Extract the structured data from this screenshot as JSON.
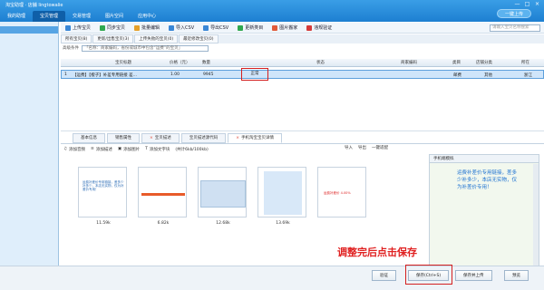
{
  "app": {
    "title": "淘宝助理 · 店舖 lingtowalie",
    "minimize_label": "—",
    "maximize_label": "□",
    "close_label": "×"
  },
  "mainnav": {
    "tabs": [
      {
        "label": "我的助理"
      },
      {
        "label": "宝贝管理"
      },
      {
        "label": "交易管理"
      },
      {
        "label": "图片空间"
      },
      {
        "label": "应用中心"
      }
    ],
    "onekey_label": "一键上传"
  },
  "toolbar": {
    "items": [
      {
        "label": "上传宝贝",
        "icon": "upload-icon",
        "color": "#3a87d6"
      },
      {
        "label": "同步宝贝",
        "icon": "sync-icon",
        "color": "#2fa84f"
      },
      {
        "label": "批量编辑",
        "icon": "edit-icon",
        "color": "#e5a02a"
      },
      {
        "label": "导入CSV",
        "icon": "import-icon",
        "color": "#3a87d6"
      },
      {
        "label": "导出CSV",
        "icon": "export-icon",
        "color": "#3a87d6"
      },
      {
        "label": "更新类目",
        "icon": "refresh-icon",
        "color": "#2fa84f"
      },
      {
        "label": "图片搬家",
        "icon": "image-icon",
        "color": "#e15b3a"
      },
      {
        "label": "违规验证",
        "icon": "check-icon",
        "color": "#d43a3a"
      }
    ],
    "search_placeholder": "请输入宝贝名称搜索"
  },
  "subtabs": [
    {
      "label": "所有宝贝(8)"
    },
    {
      "label": "更新/出售宝贝(3)"
    },
    {
      "label": "上传失败的宝贝(0)"
    },
    {
      "label": "最近修改宝贝(0)"
    }
  ],
  "filter": {
    "label": "高级条件",
    "value": "「名称：商家编码，省份或城市中包含“运费”的宝贝」"
  },
  "grid": {
    "headers": [
      "宝贝标题",
      "价格（元）",
      "数量",
      "状态",
      "商家编码",
      "类目",
      "店铺分类",
      "所在"
    ],
    "row": {
      "index": "1",
      "title": "【运费】【橙子】补差专用链接 差...",
      "price": "1.00",
      "qty": "9945",
      "status": "正常",
      "cat": "邮费",
      "shopcat": "其他",
      "loc": "浙江"
    }
  },
  "detail_tabs": [
    {
      "label": "基本信息"
    },
    {
      "label": "销售属性"
    },
    {
      "label": "宝贝描述"
    },
    {
      "label": "宝贝描述源代码"
    },
    {
      "label": "手机淘宝宝贝详情"
    }
  ],
  "editor_tools": [
    {
      "label": "添加音频"
    },
    {
      "label": "添加描述"
    },
    {
      "label": "添加图片"
    },
    {
      "label": "添加文字块"
    },
    {
      "label": "(共计6kb/100kb)"
    }
  ],
  "editor_right": [
    {
      "label": "导入"
    },
    {
      "label": "导出"
    },
    {
      "label": "一键适配"
    }
  ],
  "thumbs": [
    {
      "caption": "11.59k",
      "text": "运费补差价专用链接，差多少补多少，本店无实物，仅为补差价专用！"
    },
    {
      "caption": "6.82k"
    },
    {
      "caption": "12.68k"
    },
    {
      "caption": "13.69k"
    }
  ],
  "thumb5_text": "运费补差价 4.00%",
  "preview": {
    "header": "手机端模拟",
    "text": "运费补差价专用链接，差多少补多少，本店无实物，仅为补差价专用！"
  },
  "annotation": "调整完后点击保存",
  "bottom": {
    "verify": "验证",
    "save": "保存(Ctrl+S)",
    "save_upload": "保存并上传",
    "preview": "预览"
  }
}
